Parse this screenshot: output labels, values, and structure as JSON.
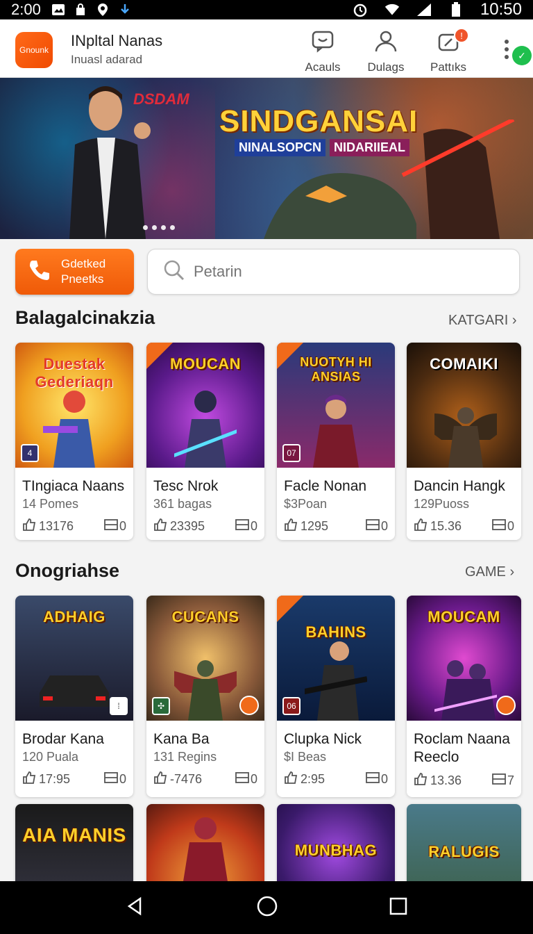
{
  "status_bar": {
    "time": "2:00",
    "clock": "10:50"
  },
  "app": {
    "logo_text": "Gnounk",
    "title": "INpltal Nanas",
    "subtitle": "Inuasl adarad"
  },
  "header_actions": [
    {
      "label": "Acauls",
      "icon": "chat-icon"
    },
    {
      "label": "Dulags",
      "icon": "user-icon"
    },
    {
      "label": "Pattıks",
      "icon": "notification-icon",
      "badge": "!"
    }
  ],
  "banner": {
    "tag": "DSDAM",
    "title": "SINDGANSAI",
    "sub_left": "NINALSOPCN",
    "sub_right": "NIDARIIEAL"
  },
  "cta": {
    "line1": "Gdetked",
    "line2": "Pneetks"
  },
  "search": {
    "placeholder": "Petarin"
  },
  "section1": {
    "title": "Balagalcinakzia",
    "link": "KATGARI",
    "cards": [
      {
        "art_title": "Duestak Gederiaqn",
        "name": "TIngiaca Naans",
        "meta": "14 Pomes",
        "likes": "13176",
        "count": "0",
        "badge": "4"
      },
      {
        "art_title": "MOUCAN",
        "name": "Tesc Nrok",
        "meta": "361 bagas",
        "likes": "23395",
        "count": "0"
      },
      {
        "art_title": "NUOTYH HI ANSIAS",
        "name": "Facle Nonan",
        "meta": "$3Poan",
        "likes": "1295",
        "count": "0",
        "badge": "07"
      },
      {
        "art_title": "COMAIKI",
        "name": "Dancin Hangk",
        "meta": "129Puoss",
        "likes": "15.36",
        "count": "0"
      }
    ]
  },
  "section2": {
    "title": "Onogriahse",
    "link": "GAME",
    "cards": [
      {
        "art_title": "ADHAIG",
        "name": "Brodar Kana",
        "meta": "120 Puala",
        "likes": "17:95",
        "count": "0"
      },
      {
        "art_title": "CUCANS",
        "name": "Kana Ba",
        "meta": "131 Regins",
        "likes": "-7476",
        "count": "0"
      },
      {
        "art_title": "BAHINS",
        "name": "Clupka Nick",
        "meta": "$I Beas",
        "likes": "2:95",
        "count": "0",
        "badge": "06"
      },
      {
        "art_title": "MOUCAM",
        "name": "Roclam Naana Reeclo",
        "meta": "",
        "likes": "13.36",
        "count": "7"
      }
    ]
  },
  "section3": {
    "cards": [
      {
        "art_title": "AIA MANIS"
      },
      {
        "art_title": ""
      },
      {
        "art_title": "MUNBHAG"
      },
      {
        "art_title": "RALUGIS"
      }
    ]
  },
  "colors": {
    "accent": "#f05a0a",
    "badge": "#f0542a",
    "green": "#1fbf4e"
  }
}
